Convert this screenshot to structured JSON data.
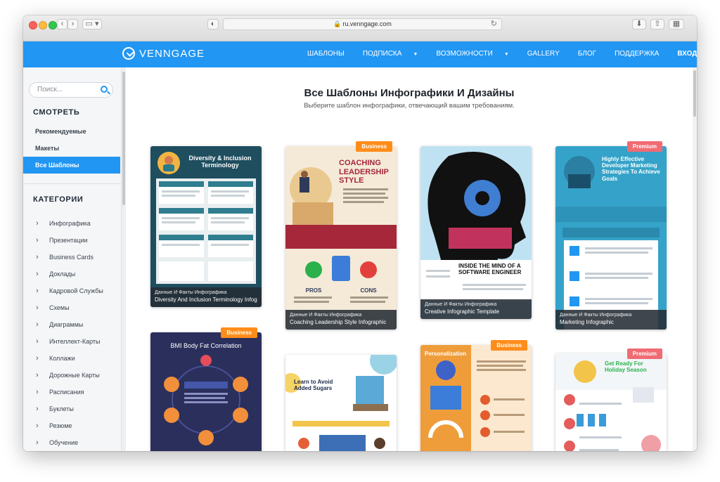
{
  "browser": {
    "url": "ru.venngage.com"
  },
  "nav": {
    "logo": "VENNGAGE",
    "items": [
      {
        "label": "ШАБЛОНЫ",
        "caret": false
      },
      {
        "label": "ПОДПИСКА",
        "caret": true
      },
      {
        "label": "ВОЗМОЖНОСТИ",
        "caret": true
      },
      {
        "label": "GALLERY",
        "caret": false
      },
      {
        "label": "БЛОГ",
        "caret": false
      },
      {
        "label": "ПОДДЕРЖКА",
        "caret": false
      },
      {
        "label": "ВХОД",
        "caret": false
      }
    ]
  },
  "sidebar": {
    "search_placeholder": "Поиск...",
    "view_heading": "СМОТРЕТЬ",
    "view_links": [
      "Рекомендуемые",
      "Макеты",
      "Все Шаблоны"
    ],
    "categories_heading": "КАТЕГОРИИ",
    "categories": [
      "Инфографика",
      "Презентации",
      "Business Cards",
      "Доклады",
      "Кадровой Службы",
      "Схемы",
      "Диаграммы",
      "Интеллект-Карты",
      "Коллажи",
      "Дорожные Карты",
      "Расписания",
      "Буклеты",
      "Резюме",
      "Обучение"
    ]
  },
  "main": {
    "title": "Все Шаблоны Инфографики И Дизайны",
    "subtitle": "Выберите шаблон инфографики, отвечающий вашим требованиям."
  },
  "cards": [
    {
      "badge": "",
      "caption_category": "Данные И Факты Инфографика",
      "caption_title": "Diversity And Inclusion Terminology Infogr…",
      "thumb_title": "Diversity & Inclusion Terminology"
    },
    {
      "badge": "Business",
      "caption_category": "Данные И Факты Инфографика",
      "caption_title": "Coaching Leadership Style Infographic",
      "thumb_title": "COACHING LEADERSHIP STYLE"
    },
    {
      "badge": "",
      "caption_category": "Данные И Факты Инфографика",
      "caption_title": "Creative Infographic Template",
      "thumb_title": "INSIDE THE MIND OF A SOFTWARE ENGINEER"
    },
    {
      "badge": "Premium",
      "caption_category": "Данные И Факты Инфографика",
      "caption_title": "Marketing Infographic",
      "thumb_title": "Highly Effective Developer Marketing Strategies To Achieve Goals"
    },
    {
      "badge": "Business",
      "thumb_title": "BMI Body Fat Correlation"
    },
    {
      "badge": "",
      "thumb_title": "Learn to Avoid Added Sugars"
    },
    {
      "badge": "Business",
      "thumb_title": "Personalization"
    },
    {
      "badge": "Premium",
      "thumb_title": "Get Ready For Holiday Season"
    }
  ]
}
